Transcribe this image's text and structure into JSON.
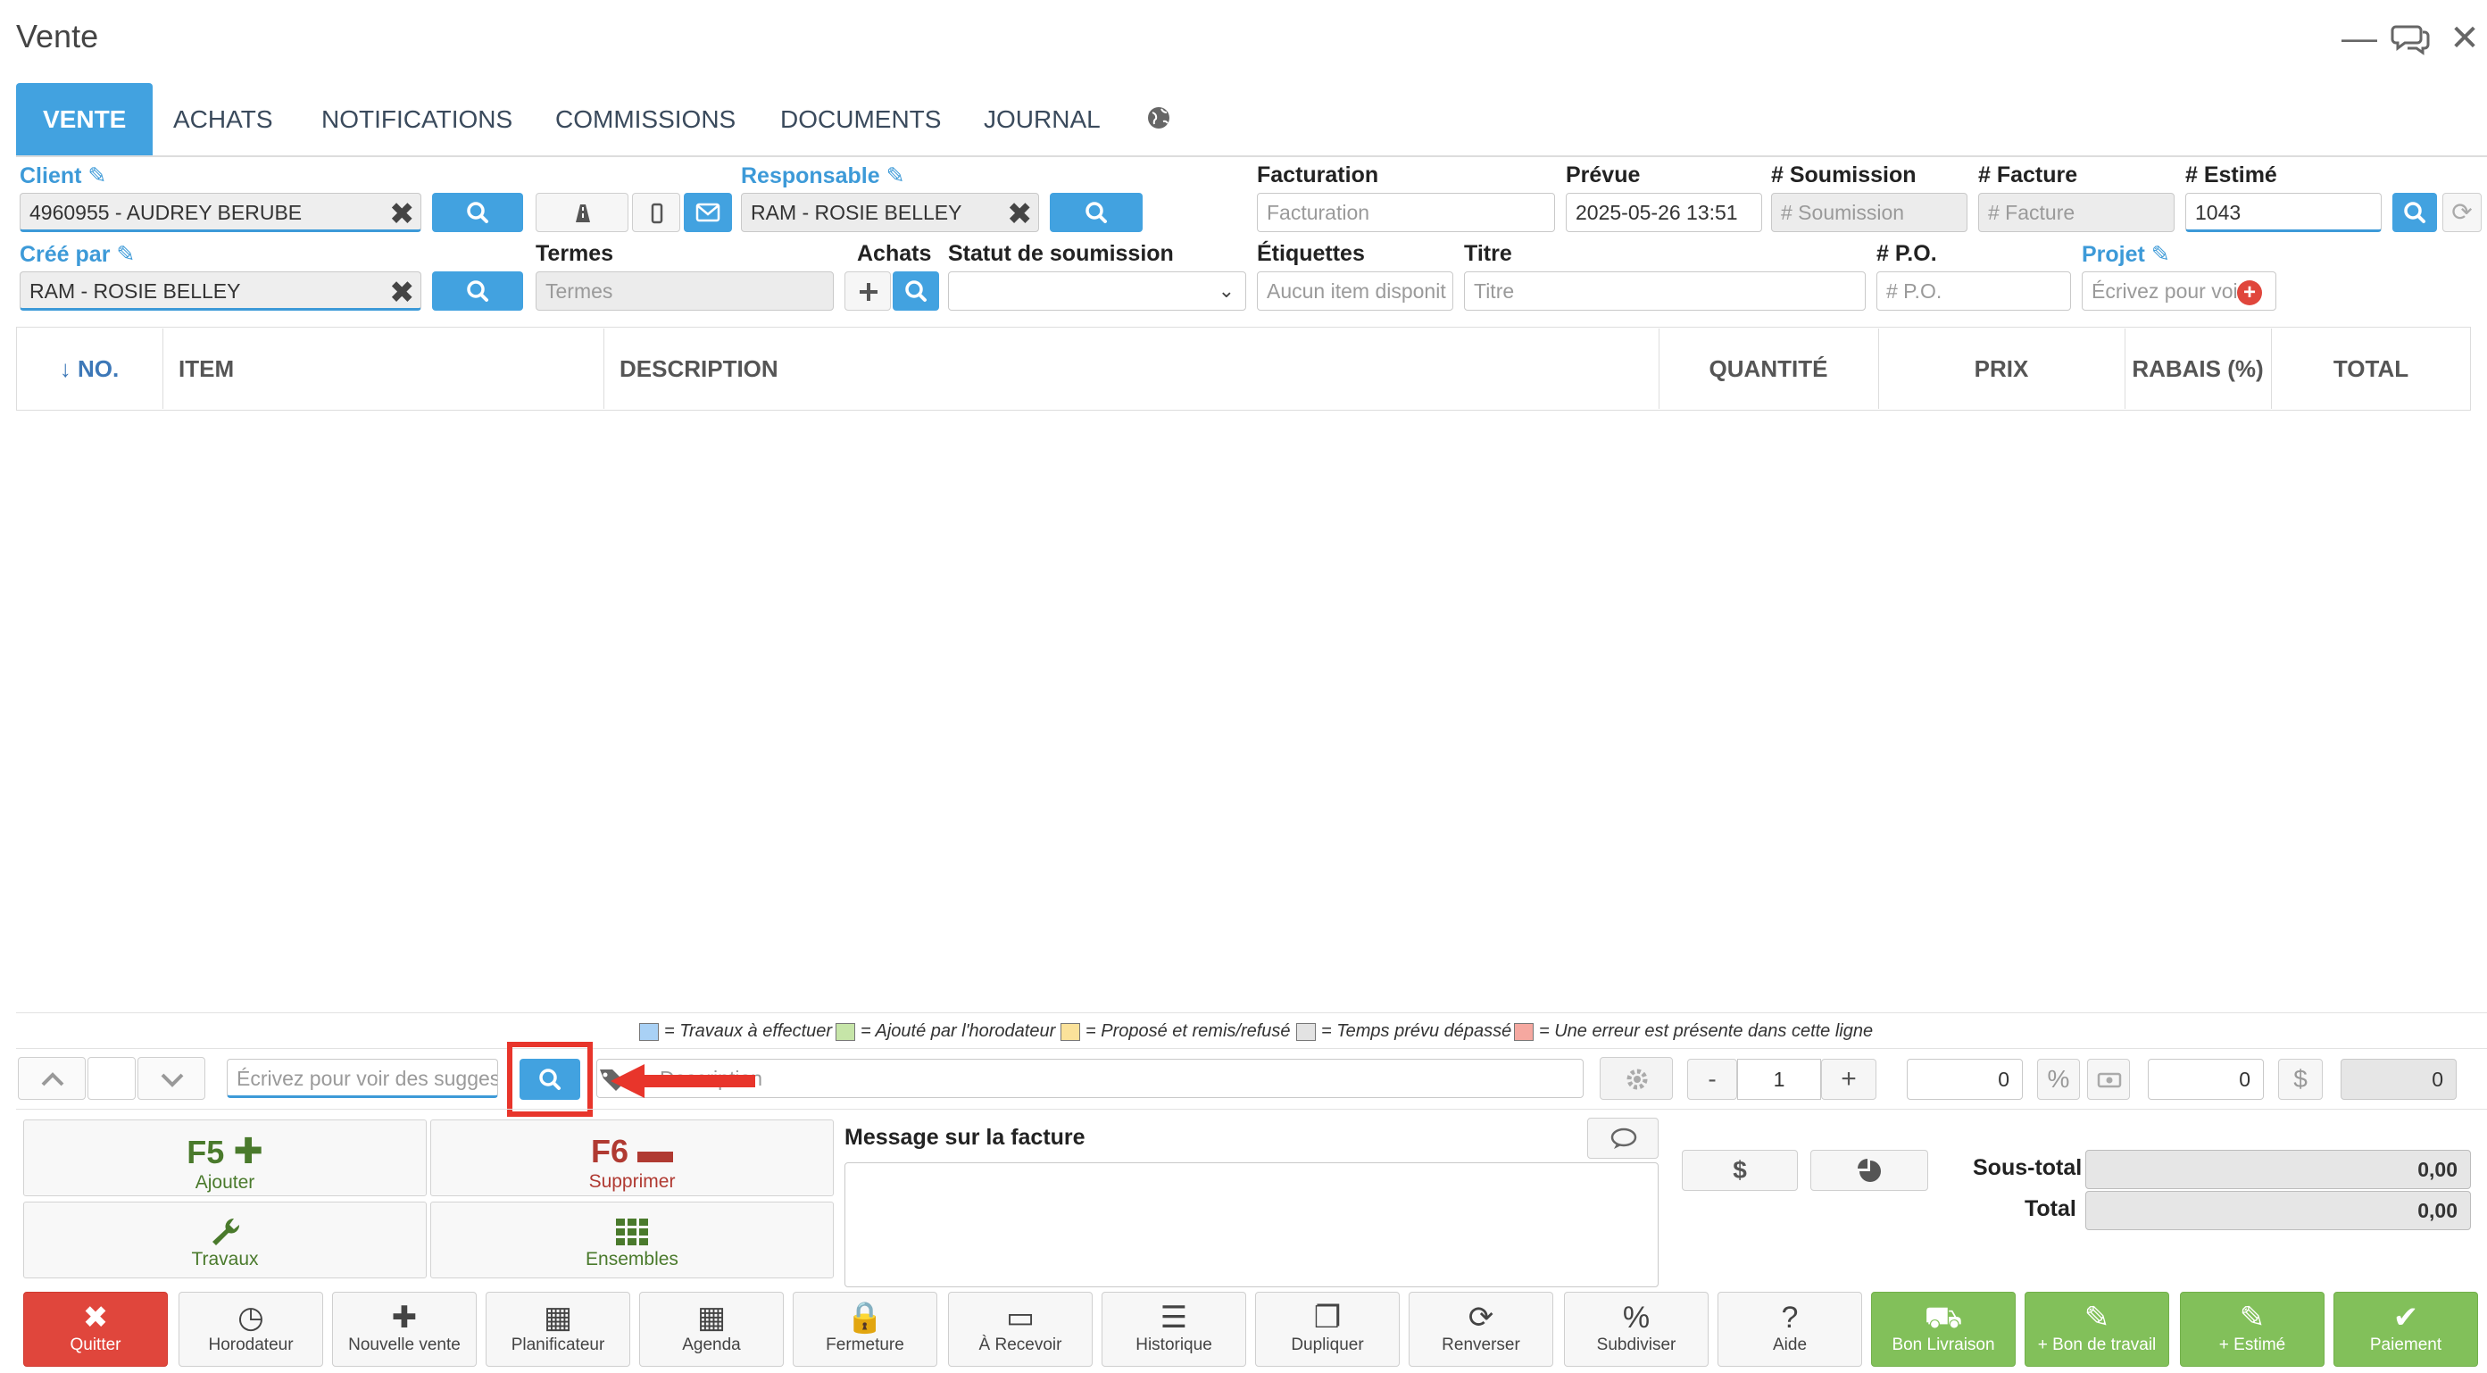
{
  "window": {
    "title": "Vente"
  },
  "tabs": [
    {
      "label": "VENTE"
    },
    {
      "label": "ACHATS"
    },
    {
      "label": "NOTIFICATIONS"
    },
    {
      "label": "COMMISSIONS"
    },
    {
      "label": "DOCUMENTS"
    },
    {
      "label": "JOURNAL"
    }
  ],
  "form": {
    "client_label": "Client",
    "client_value": "4960955 - AUDREY BERUBE",
    "responsable_label": "Responsable",
    "responsable_value": "RAM - ROSIE BELLEY",
    "cree_par_label": "Créé par",
    "cree_par_value": "RAM - ROSIE BELLEY",
    "termes_label": "Termes",
    "termes_placeholder": "Termes",
    "achats_label": "Achats",
    "statut_label": "Statut de soumission",
    "statut_value": "",
    "facturation_label": "Facturation",
    "facturation_placeholder": "Facturation",
    "prevue_label": "Prévue",
    "prevue_value": "2025-05-26 13:51",
    "soumission_label": "# Soumission",
    "soumission_placeholder": "# Soumission",
    "facture_label": "# Facture",
    "facture_placeholder": "# Facture",
    "estime_label": "# Estimé",
    "estime_value": "1043",
    "etiquettes_label": "Étiquettes",
    "etiquettes_placeholder": "Aucun item disponit",
    "titre_label": "Titre",
    "titre_placeholder": "Titre",
    "po_label": "# P.O.",
    "po_placeholder": "# P.O.",
    "projet_label": "Projet",
    "projet_placeholder": "Écrivez pour voir"
  },
  "table": {
    "headers": [
      "↓ NO.",
      "ITEM",
      "DESCRIPTION",
      "QUANTITÉ",
      "PRIX",
      "RABAIS (%)",
      "TOTAL"
    ]
  },
  "legend": [
    {
      "color": "#a9d1f5",
      "text": "= Travaux à effectuer"
    },
    {
      "color": "#c6e5a8",
      "text": "= Ajouté par l'horodateur"
    },
    {
      "color": "#fbe29a",
      "text": "= Proposé et remis/refusé"
    },
    {
      "color": "#e3e3e3",
      "text": "= Temps prévu dépassé"
    },
    {
      "color": "#f5a8a0",
      "text": "= Une erreur est présente dans cette ligne"
    }
  ],
  "entry": {
    "item_placeholder": "Écrivez pour voir des suggest",
    "description_placeholder": "Description",
    "qty_minus": "-",
    "qty_value": "1",
    "qty_plus": "+",
    "rabais_value": "0",
    "percent_symbol": "%",
    "price_value": "0",
    "dollar_symbol": "$",
    "total_value": "0"
  },
  "actions": {
    "add_key": "F5",
    "add_label": "Ajouter",
    "del_key": "F6",
    "del_label": "Supprimer",
    "travaux_label": "Travaux",
    "ensembles_label": "Ensembles",
    "message_label": "Message sur la facture",
    "dollar_btn": "$"
  },
  "totals": {
    "sous_total_label": "Sous-total",
    "sous_total_value": "0,00",
    "total_label": "Total",
    "total_value": "0,00"
  },
  "bottom_buttons": [
    {
      "label": "Quitter",
      "icon": "✖"
    },
    {
      "label": "Horodateur",
      "icon": "◷"
    },
    {
      "label": "Nouvelle vente",
      "icon": "✚"
    },
    {
      "label": "Planificateur",
      "icon": "▦"
    },
    {
      "label": "Agenda",
      "icon": "▦"
    },
    {
      "label": "Fermeture",
      "icon": "🔒"
    },
    {
      "label": "À Recevoir",
      "icon": "▭"
    },
    {
      "label": "Historique",
      "icon": "☰"
    },
    {
      "label": "Dupliquer",
      "icon": "❐"
    },
    {
      "label": "Renverser",
      "icon": "⟳"
    },
    {
      "label": "Subdiviser",
      "icon": "%"
    },
    {
      "label": "Aide",
      "icon": "?"
    },
    {
      "label": "Bon Livraison",
      "icon": "⛟"
    },
    {
      "label": "+ Bon de travail",
      "icon": "✎"
    },
    {
      "label": "+ Estimé",
      "icon": "✎"
    },
    {
      "label": "Paiement",
      "icon": "✔"
    }
  ],
  "colors": {
    "accent": "#42a2e0",
    "danger": "#e0463c",
    "success": "#82c05a",
    "highlight": "#e8352b"
  }
}
